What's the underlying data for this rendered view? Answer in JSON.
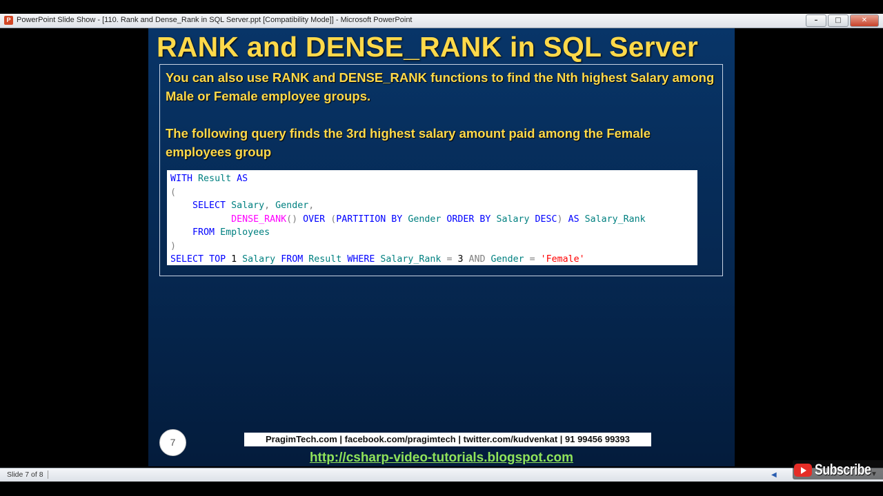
{
  "window": {
    "title": "PowerPoint Slide Show - [110. Rank and Dense_Rank in SQL Server.ppt [Compatibility Mode]] - Microsoft PowerPoint",
    "app_icon": "P",
    "minimize": "–",
    "maximize": "□",
    "close": "✕"
  },
  "slide": {
    "title": "RANK and DENSE_RANK in SQL Server",
    "paragraph1": "You can also use RANK and DENSE_RANK functions to find the Nth highest Salary among Male or Female employee groups.",
    "paragraph2": "The following query finds the 3rd highest salary amount paid among the Female employees group",
    "code": {
      "l1": {
        "kw1": "WITH",
        "id1": "Result",
        "kw2": "AS"
      },
      "l2": {
        "p": "("
      },
      "l3": {
        "kw1": "SELECT",
        "id1": "Salary",
        "c1": ",",
        "id2": "Gender",
        "c2": ","
      },
      "l4": {
        "fn": "DENSE_RANK",
        "p1": "()",
        "kw1": "OVER",
        "p2": "(",
        "kw2": "PARTITION BY",
        "id1": "Gender",
        "kw3": "ORDER BY",
        "id2": "Salary",
        "kw4": "DESC",
        "p3": ")",
        "kw5": "AS",
        "id3": "Salary_Rank"
      },
      "l5": {
        "kw1": "FROM",
        "id1": "Employees"
      },
      "l6": {
        "p": ")"
      },
      "l7": {
        "kw1": "SELECT",
        "kw2": "TOP",
        "n1": "1",
        "id1": "Salary",
        "kw3": "FROM",
        "id2": "Result",
        "kw4": "WHERE",
        "id3": "Salary_Rank",
        "op1": "=",
        "n2": "3",
        "op2": "AND",
        "id4": "Gender",
        "op3": "=",
        "str": "'Female'"
      }
    },
    "number": "7",
    "footer_contacts": "PragimTech.com | facebook.com/pragimtech | twitter.com/kudvenkat | 91 99456 99393",
    "footer_link": "http://csharp-video-tutorials.blogspot.com"
  },
  "statusbar": {
    "slide_indicator": "Slide 7 of 8"
  },
  "watermark": {
    "subscribe_label": "Subscribe"
  },
  "colors": {
    "title_yellow": "#ffd94a",
    "slide_bg": "#062a55",
    "link_green": "#8fe35a",
    "sql_keyword": "#0000ff",
    "sql_identifier": "#008080",
    "sql_function": "#ff00ff",
    "sql_string": "#ff0000"
  }
}
